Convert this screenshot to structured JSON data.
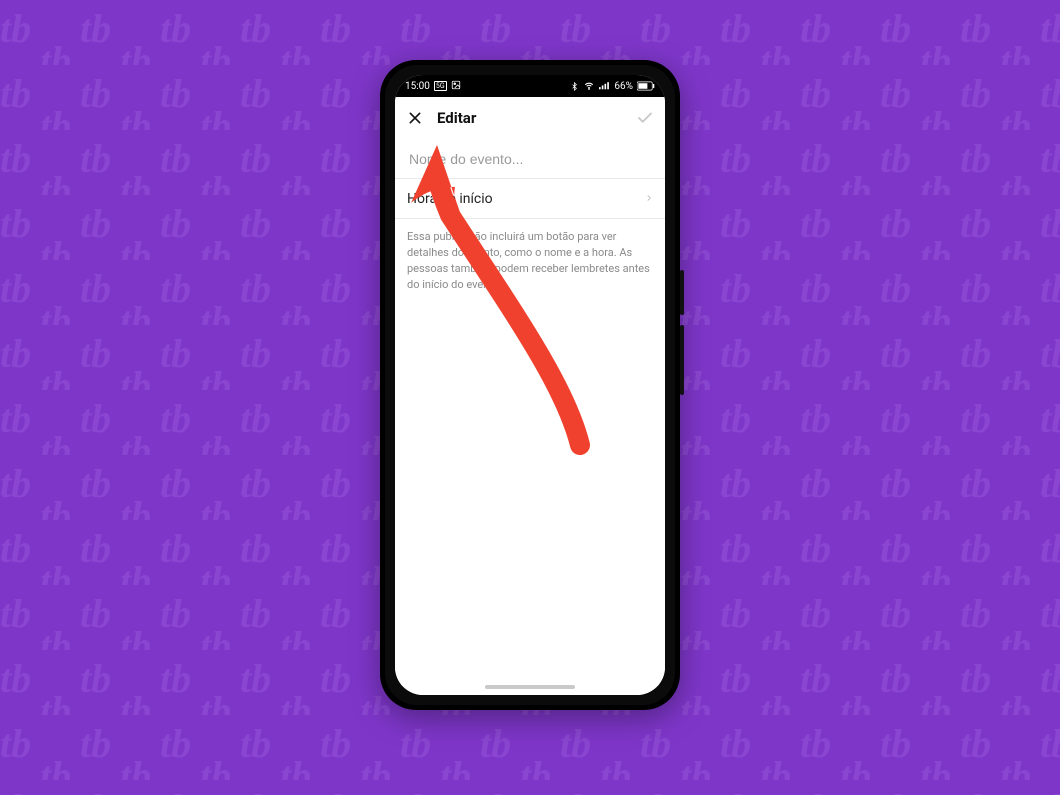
{
  "background": {
    "color": "#7e36c9",
    "pattern_text": "tb"
  },
  "device": {
    "type": "smartphone",
    "frame_color": "#000000"
  },
  "statusbar": {
    "time": "15:00",
    "indicators_left": [
      "5G",
      "image-icon"
    ],
    "indicators_right": [
      "bluetooth",
      "wifi",
      "signal"
    ],
    "battery_percent": "66%"
  },
  "header": {
    "close_icon": "close-x",
    "title": "Editar",
    "confirm_icon": "checkmark",
    "confirm_enabled": false
  },
  "event_name": {
    "placeholder": "Nome do evento...",
    "value": ""
  },
  "start_time_row": {
    "label": "Hora de início",
    "chevron": "right"
  },
  "info_text": "Essa publicação incluirá um botão para ver detalhes do evento, como o nome e a hora. As pessoas também podem receber lembretes antes do início do evento.",
  "annotation": {
    "type": "curved-arrow",
    "color": "#f0412f",
    "points_to": "event_name_input"
  }
}
